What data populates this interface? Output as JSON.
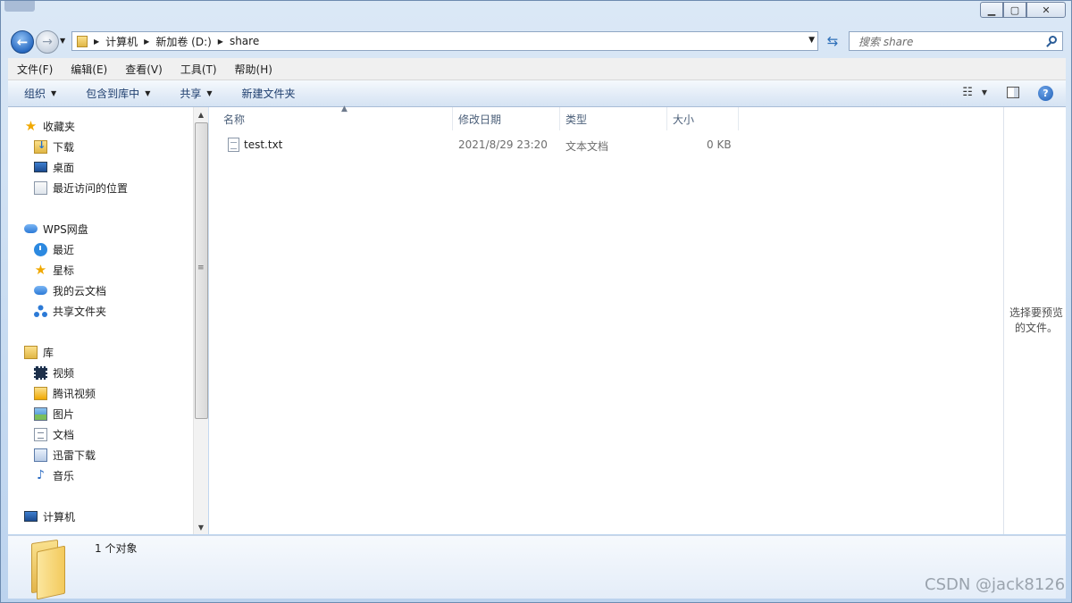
{
  "breadcrumb": [
    "计算机",
    "新加卷 (D:)",
    "share"
  ],
  "search": {
    "placeholder": "搜索 share"
  },
  "menu": [
    "文件(F)",
    "编辑(E)",
    "查看(V)",
    "工具(T)",
    "帮助(H)"
  ],
  "toolbar": {
    "organize": "组织",
    "include_library": "包含到库中",
    "share": "共享",
    "new_folder": "新建文件夹"
  },
  "sidebar": {
    "favorites": {
      "title": "收藏夹",
      "items": [
        "下载",
        "桌面",
        "最近访问的位置"
      ]
    },
    "wps": {
      "title": "WPS网盘",
      "items": [
        "最近",
        "星标",
        "我的云文档",
        "共享文件夹"
      ]
    },
    "libraries": {
      "title": "库",
      "items": [
        "视频",
        "腾讯视频",
        "图片",
        "文档",
        "迅雷下载",
        "音乐"
      ]
    },
    "computer": {
      "title": "计算机"
    }
  },
  "columns": {
    "name": "名称",
    "modified": "修改日期",
    "type": "类型",
    "size": "大小"
  },
  "files": [
    {
      "name": "test.txt",
      "modified": "2021/8/29 23:20",
      "type": "文本文档",
      "size": "0 KB"
    }
  ],
  "preview": {
    "line1": "选择要预览",
    "line2": "的文件。"
  },
  "details": {
    "count": "1 个对象"
  },
  "watermark": "CSDN @jack8126",
  "colors": {
    "toolbar_text": "#1e3e6e",
    "column_header": "#4c607a",
    "accent": "#2a6bc2"
  }
}
